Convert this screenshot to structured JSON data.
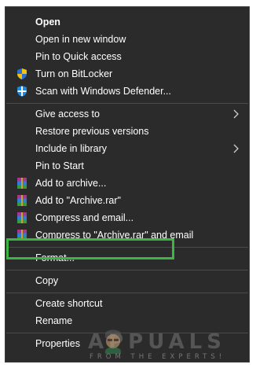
{
  "menu": {
    "items": [
      {
        "label": "Open",
        "bold": true,
        "icon": "",
        "submenu": false
      },
      {
        "label": "Open in new window",
        "bold": false,
        "icon": "",
        "submenu": false
      },
      {
        "label": "Pin to Quick access",
        "bold": false,
        "icon": "",
        "submenu": false
      },
      {
        "label": "Turn on BitLocker",
        "bold": false,
        "icon": "shield-uac-icon",
        "submenu": false
      },
      {
        "label": "Scan with Windows Defender...",
        "bold": false,
        "icon": "defender-icon",
        "submenu": false
      },
      {
        "label": "Give access to",
        "bold": false,
        "icon": "",
        "submenu": true
      },
      {
        "label": "Restore previous versions",
        "bold": false,
        "icon": "",
        "submenu": false
      },
      {
        "label": "Include in library",
        "bold": false,
        "icon": "",
        "submenu": true
      },
      {
        "label": "Pin to Start",
        "bold": false,
        "icon": "",
        "submenu": false
      },
      {
        "label": "Add to archive...",
        "bold": false,
        "icon": "winrar-icon",
        "submenu": false
      },
      {
        "label": "Add to \"Archive.rar\"",
        "bold": false,
        "icon": "winrar-icon",
        "submenu": false
      },
      {
        "label": "Compress and email...",
        "bold": false,
        "icon": "winrar-icon",
        "submenu": false
      },
      {
        "label": "Compress to \"Archive.rar\" and email",
        "bold": false,
        "icon": "winrar-icon",
        "submenu": false
      },
      {
        "label": "Format...",
        "bold": false,
        "icon": "",
        "submenu": false
      },
      {
        "label": "Copy",
        "bold": false,
        "icon": "",
        "submenu": false
      },
      {
        "label": "Create shortcut",
        "bold": false,
        "icon": "",
        "submenu": false
      },
      {
        "label": "Rename",
        "bold": false,
        "icon": "",
        "submenu": false
      },
      {
        "label": "Properties",
        "bold": false,
        "icon": "",
        "submenu": false
      }
    ]
  },
  "highlight_color": "#3db543",
  "menu_background": "#2b2b2b",
  "watermark": {
    "brand": "APPUALS",
    "tagline": "FROM THE EXPERTS!"
  }
}
